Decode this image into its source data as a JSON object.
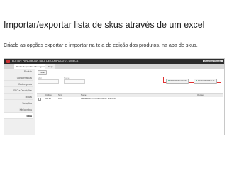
{
  "slide": {
    "title": "Importar/exportar lista de skus através de um excel",
    "caption": "Criado as opções exportar e importar na tela de edição dos produtos, na aba de skus."
  },
  "window": {
    "title": "EDITAR: PANDABOWL BALL DE COMPUTATO - DIRECA",
    "preview_button": "Visualizar Produto",
    "tabs": [
      "Dados do produto: Visão geral",
      "Preço"
    ]
  },
  "sidebar": {
    "items": [
      {
        "label": "Produto"
      },
      {
        "label": "Características"
      },
      {
        "label": "Dados gerais"
      },
      {
        "label": "SEO e Descrições"
      },
      {
        "label": "Mídias"
      },
      {
        "label": "Variações"
      },
      {
        "label": "Kits/combos"
      },
      {
        "label": "Skus"
      }
    ]
  },
  "main": {
    "edit_button": "Filtrar",
    "filter_labels": [
      "SKU",
      "Nome"
    ],
    "import_label": "IMPORTAR SKUS",
    "export_label": "EXPORTAR SKUS",
    "table": {
      "headers": [
        "Código",
        "SKU",
        "Nome",
        "Opções"
      ],
      "rows": [
        {
          "codigo": "84794",
          "sku": "1001",
          "nome": "Pandabowl em Cores Lustro - Infantina"
        }
      ]
    }
  }
}
